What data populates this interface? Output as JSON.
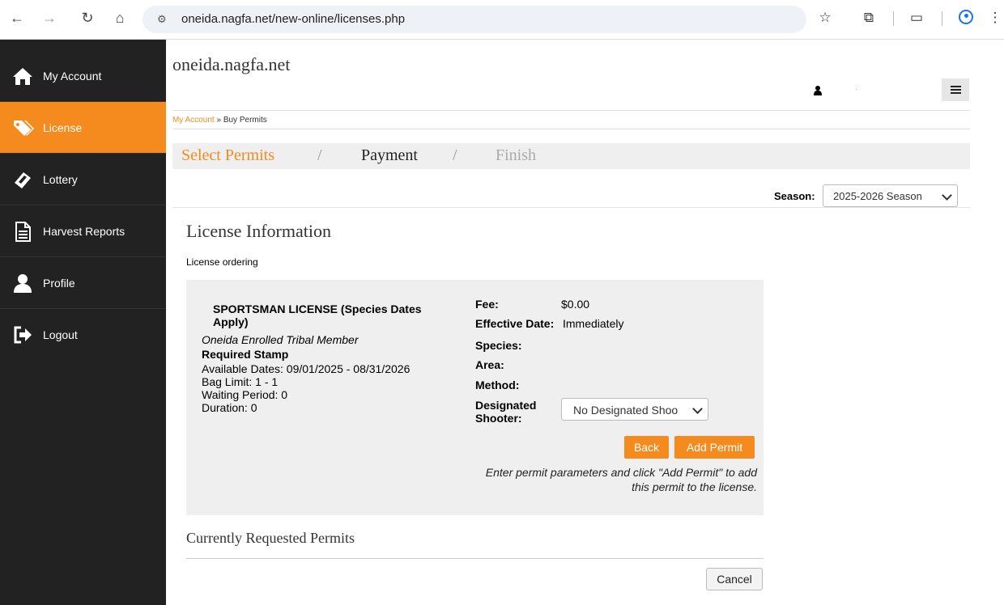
{
  "browser": {
    "url": "oneida.nagfa.net/new-online/licenses.php"
  },
  "sidebar": {
    "items": [
      {
        "label": "My Account",
        "icon": "home-icon"
      },
      {
        "label": "License",
        "icon": "tags-icon",
        "active": true
      },
      {
        "label": "Lottery",
        "icon": "ticket-icon"
      },
      {
        "label": "Harvest Reports",
        "icon": "document-icon"
      },
      {
        "label": "Profile",
        "icon": "user-icon"
      },
      {
        "label": "Logout",
        "icon": "logout-icon"
      }
    ]
  },
  "header": {
    "site_title": "oneida.nagfa.net",
    "user_name": "."
  },
  "breadcrumb": {
    "link": "My Account",
    "separator": "»",
    "current": "Buy Permits"
  },
  "steps": {
    "items": [
      "Select Permits",
      "Payment",
      "Finish"
    ],
    "separator": "/"
  },
  "season": {
    "label": "Season:",
    "selected": "2025-2026 Season"
  },
  "license_info": {
    "title": "License Information",
    "subtitle": "License ordering"
  },
  "permit": {
    "name": "SPORTSMAN LICENSE (Species Dates Apply)",
    "eligibility": "Oneida Enrolled Tribal Member",
    "stamp": "Required Stamp",
    "available_dates": "Available Dates: 09/01/2025 - 08/31/2026",
    "bag_limit": "Bag Limit: 1 - 1",
    "waiting_period": "Waiting Period: 0",
    "duration": "Duration: 0",
    "fields": {
      "fee_label": "Fee:",
      "fee_value": "$0.00",
      "effective_label": "Effective Date:",
      "effective_value": "Immediately",
      "species_label": "Species:",
      "area_label": "Area:",
      "method_label": "Method:",
      "shooter_label": "Designated Shooter:",
      "shooter_selected": "No Designated Shoo"
    },
    "back_label": "Back",
    "add_label": "Add Permit",
    "hint": "Enter permit parameters and click \"Add Permit\" to add this permit to the license."
  },
  "requested": {
    "title": "Currently Requested Permits",
    "cancel_label": "Cancel"
  },
  "colors": {
    "accent": "#f58a1f",
    "sidebar_bg": "#222222",
    "panel_bg": "#efefef"
  }
}
